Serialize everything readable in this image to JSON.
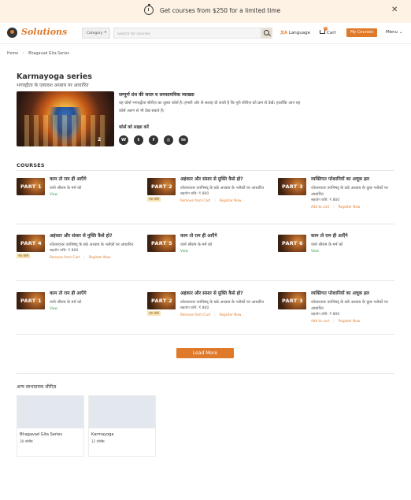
{
  "promo": {
    "text": "Get courses from $250 for a limited time",
    "close": "✕"
  },
  "header": {
    "logo": "Solutions",
    "category": "Category",
    "search_placeholder": "Search for courses",
    "language": "Language",
    "cart": "Cart",
    "cart_count": "0",
    "my_courses": "My Courses",
    "menu": "Menu"
  },
  "breadcrumb": {
    "home": "Home",
    "current": "Bhagavad Gita Series"
  },
  "series": {
    "title": "Karmayoga series",
    "subtitle": "भगवद्गीता के एकादश अध्याय पर आधारित",
    "badge": "2",
    "desc_title": "सम्पूर्ण ग्रंथ की सरल व समसामयिक व्याख्या",
    "desc_line1": "यह कोर्स भगवद्गीता सीरीज़ का दूसरा कोर्स है। हमारी ओर से सलाह दी जाती है कि पूरी सीरीज़ को क्रम से देखें। हालाँकि आप यह",
    "desc_line2": "कोर्स अलग से भी देख सकते हैं।",
    "share_title": "कोर्स को साझा करें",
    "share": [
      "W",
      "t",
      "f",
      "◎",
      "in"
    ]
  },
  "courses_heading": "COURSES",
  "courses": [
    {
      "part": "PART 1",
      "title": "काम तो राम ही आएँगे",
      "desc": "जाने श्रीराम के मर्म को",
      "view": "View"
    },
    {
      "part": "PART 2",
      "title": "अहंकार और संसार से मुक्ति कैसे हो?",
      "desc": "श्वेताश्वतर उपनिषद् के छठे अध्याय के श्लोकों पर आधारित",
      "price": "सहयोग राशि: ₹ 800",
      "tag": "नया कोर्स",
      "a1": "Remove from Cart",
      "a2": "Register Now"
    },
    {
      "part": "PART 3",
      "title": "व्यक्तिगत परेशानियों का अचूक इल",
      "desc": "श्वेताश्वतर उपनिषद् के छठे अध्याय के कुछ श्लोकों पर आधारित",
      "price": "सहयोग राशि: ₹ 800",
      "a1": "Add to cart",
      "a2": "Register Now"
    },
    {
      "part": "PART 4",
      "title": "अहंकार और संसार से मुक्ति कैसे हो?",
      "desc": "श्वेताश्वतर उपनिषद् के छठे अध्याय के श्लोकों पर आधारित",
      "price": "सहयोग राशि: ₹ 800",
      "tag": "नया कोर्स",
      "a1": "Remove from Cart",
      "a2": "Register Now"
    },
    {
      "part": "PART 5",
      "title": "काम तो राम ही आएँगे",
      "desc": "जाने श्रीराम के मर्म को",
      "view": "View"
    },
    {
      "part": "PART 6",
      "title": "काम तो राम ही आएँगे",
      "desc": "जाने श्रीराम के मर्म को",
      "view": "View"
    },
    {
      "part": "PART 1",
      "title": "काम तो राम ही आएँगे",
      "desc": "जाने श्रीराम के मर्म को",
      "view": "View"
    },
    {
      "part": "PART 2",
      "title": "अहंकार और संसार से मुक्ति कैसे हो?",
      "desc": "श्वेताश्वतर उपनिषद् के छठे अध्याय के श्लोकों पर आधारित",
      "price": "सहयोग राशि: ₹ 800",
      "tag": "नया कोर्स",
      "a1": "Remove from Cart",
      "a2": "Register Now"
    },
    {
      "part": "PART 3",
      "title": "व्यक्तिगत परेशानियों का अचूक इल",
      "desc": "श्वेताश्वतर उपनिषद् के छठे अध्याय के कुछ श्लोकों पर आधारित",
      "price": "सहयोग राशि: ₹ 800",
      "a1": "Add to cart",
      "a2": "Register Now"
    }
  ],
  "load_more": "Load More",
  "other_heading": "अन्य लाभदायक सीरीज़",
  "other_series": [
    {
      "name": "Bhagavad Gita Series",
      "count": "30 कोर्सेस"
    },
    {
      "name": "Karmayoga",
      "count": "12 कोर्सेस"
    }
  ],
  "colors": {
    "accent": "#e07a2b",
    "view": "#3a9a4a",
    "banner": "#fdf2e4"
  }
}
